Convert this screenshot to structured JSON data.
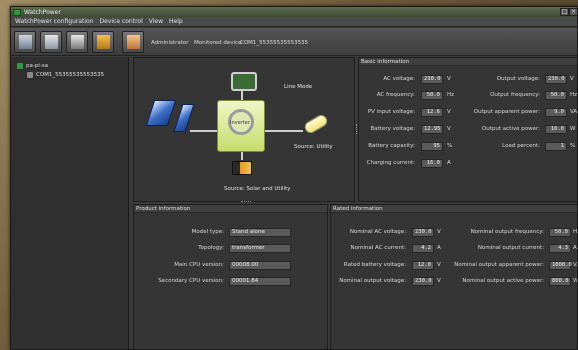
{
  "window": {
    "title": "WatchPower"
  },
  "menu": [
    "WatchPower configuration",
    "Device control",
    "View",
    "Help"
  ],
  "toolbar": {
    "user_role": "Administrator",
    "monitored_label": "Monitored device:",
    "monitored_device": "COM1_55355535553535"
  },
  "tree": {
    "root": "pa-pi-sa",
    "device": "COM1_55355535553535"
  },
  "diagram": {
    "mode": "Line Mode",
    "grid_source": "Source:  Utility",
    "inverter_label": "Inverter",
    "battery_source": "Source:  Solar and Utility"
  },
  "basic": {
    "title": "Basic information",
    "left": [
      {
        "label": "AC voltage:",
        "value": "230.0",
        "unit": "V"
      },
      {
        "label": "AC frequency:",
        "value": "50.0",
        "unit": "Hz"
      },
      {
        "label": "PV input voltage:",
        "value": "12.6",
        "unit": "V"
      },
      {
        "label": "Battery voltage:",
        "value": "12.95",
        "unit": "V"
      },
      {
        "label": "Battery capacity:",
        "value": "95",
        "unit": "%"
      },
      {
        "label": "Charging current:",
        "value": "16.0",
        "unit": "A"
      }
    ],
    "right": [
      {
        "label": "Output voltage:",
        "value": "230.0",
        "unit": "V"
      },
      {
        "label": "Output frequency:",
        "value": "50.0",
        "unit": "Hz"
      },
      {
        "label": "Output apparent power:",
        "value": "9.0",
        "unit": "VA"
      },
      {
        "label": "Output active power:",
        "value": "10.0",
        "unit": "W"
      },
      {
        "label": "Load percent:",
        "value": "1",
        "unit": "%"
      }
    ]
  },
  "product": {
    "title": "Product information",
    "rows": [
      {
        "label": "Model type:",
        "value": "Stand alone"
      },
      {
        "label": "Topology:",
        "value": "transformer"
      },
      {
        "label": "Main CPU version:",
        "value": "00008.00"
      },
      {
        "label": "Secondary CPU version:",
        "value": "00001.84"
      }
    ]
  },
  "rated": {
    "title": "Rated information",
    "left": [
      {
        "label": "Nominal AC voltage:",
        "value": "230.0",
        "unit": "V"
      },
      {
        "label": "Nominal AC current:",
        "value": "4.2",
        "unit": "A"
      },
      {
        "label": "Rated battery voltage:",
        "value": "12.0",
        "unit": "V"
      },
      {
        "label": "Nominal output voltage:",
        "value": "230.0",
        "unit": "V"
      }
    ],
    "right": [
      {
        "label": "Nominal output frequency:",
        "value": "50.0",
        "unit": "Hz"
      },
      {
        "label": "Nominal output current:",
        "value": "4.3",
        "unit": "A"
      },
      {
        "label": "Nominal output apparent power:",
        "value": "1000.0",
        "unit": "VA"
      },
      {
        "label": "Nominal output active power:",
        "value": "800.0",
        "unit": "W"
      }
    ]
  },
  "colors": {
    "accent_green": "#2f9a3b",
    "panel": "#353535",
    "field": "#5a5a5a"
  },
  "icons": [
    "monitor-icon",
    "settings-icon",
    "camera-icon",
    "lock-icon",
    "users-icon",
    "solar-panel-icon",
    "grid-icon",
    "bulb-icon",
    "battery-icon"
  ]
}
